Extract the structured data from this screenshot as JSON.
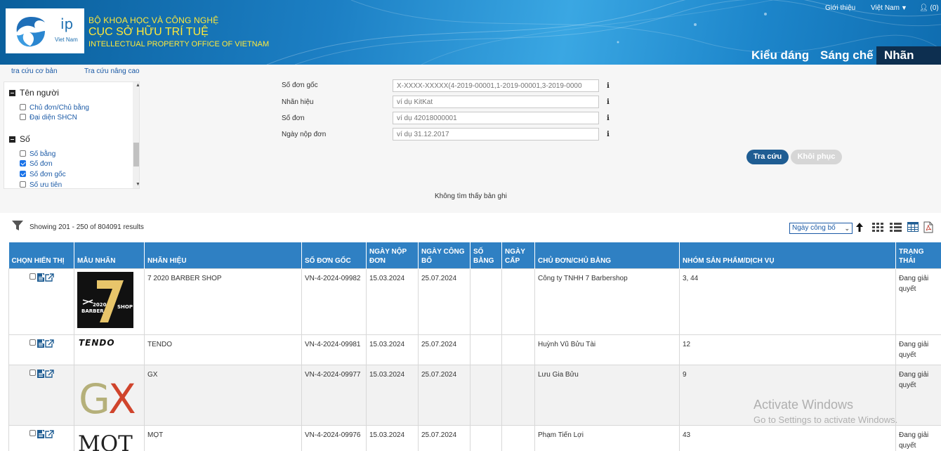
{
  "header": {
    "logo": {
      "ip_text": "ip",
      "sub_text": "Viet Nam"
    },
    "org_line1": "BỘ KHOA HỌC VÀ CÔNG NGHỆ",
    "org_line2": "CỤC SỞ HỮU TRÍ TUỆ",
    "org_line3": "INTELLECTUAL PROPERTY OFFICE OF VIETNAM",
    "links": {
      "intro": "Giới thiệu",
      "language": "Việt Nam",
      "user": "(0)"
    },
    "tabs": [
      {
        "label": "Kiểu dáng",
        "active": false
      },
      {
        "label": "Sáng chế",
        "active": false
      },
      {
        "label": "Nhãn hiệu",
        "active": true
      }
    ]
  },
  "search_modes": {
    "basic": "tra cứu cơ bản",
    "advanced": "Tra cứu nâng cao"
  },
  "filters": {
    "groups": [
      {
        "title": "Tên người",
        "items": [
          {
            "label": "Chủ đơn/Chủ bằng",
            "checked": false
          },
          {
            "label": "Đại diện SHCN",
            "checked": false
          }
        ]
      },
      {
        "title": "Số",
        "items": [
          {
            "label": "Số bằng",
            "checked": false
          },
          {
            "label": "Số đơn",
            "checked": true
          },
          {
            "label": "Số đơn gốc",
            "checked": true
          },
          {
            "label": "Số ưu tiên",
            "checked": false
          }
        ]
      }
    ]
  },
  "form": {
    "fields": [
      {
        "label": "Số đơn gốc",
        "placeholder": "X-XXXX-XXXXX(4-2019-00001,1-2019-00001,3-2019-0000",
        "value": ""
      },
      {
        "label": "Nhãn hiệu",
        "placeholder": "ví dụ KitKat",
        "value": ""
      },
      {
        "label": "Số đơn",
        "placeholder": "ví dụ 42018000001",
        "value": ""
      },
      {
        "label": "Ngày nộp đơn",
        "placeholder": "ví dụ 31.12.2017",
        "value": ""
      }
    ],
    "info_glyph": "i",
    "search_button": "Tra cứu",
    "reset_button": "Khôi phục",
    "no_records": "Không tìm thấy bản ghi"
  },
  "results": {
    "showing": "Showing 201 - 250 of 804091 results",
    "sort_by": "Ngày công bố",
    "columns": [
      "Chọn hiển thị",
      "Mẫu nhãn",
      "Nhãn hiệu",
      "Số đơn gốc",
      "Ngày nộp đơn",
      "Ngày công bố",
      "Số bằng",
      "Ngày cấp",
      "Chủ đơn/Chủ bằng",
      "Nhóm sản phẩm/dịch vụ",
      "Trạng thái"
    ],
    "rows": [
      {
        "mark": "7 2020 BARBER SHOP",
        "app_no": "VN-4-2024-09982",
        "filing_date": "15.03.2024",
        "pub_date": "25.07.2024",
        "reg_no": "",
        "grant_date": "",
        "owner": "Công ty TNHH 7 Barbershop",
        "classes": "3, 44",
        "status": "Đang giải quyết",
        "logo": {
          "big": "7",
          "text_top": "2020",
          "text_left": "BARBER",
          "text_right": "SHOP"
        }
      },
      {
        "mark": "TENDO",
        "app_no": "VN-4-2024-09981",
        "filing_date": "15.03.2024",
        "pub_date": "25.07.2024",
        "reg_no": "",
        "grant_date": "",
        "owner": "Huỳnh Vũ Bửu Tài",
        "classes": "12",
        "status": "Đang giải quyết",
        "logo": {
          "text": "TENDO"
        }
      },
      {
        "mark": "GX",
        "app_no": "VN-4-2024-09977",
        "filing_date": "15.03.2024",
        "pub_date": "25.07.2024",
        "reg_no": "",
        "grant_date": "",
        "owner": "Lưu Gia Bửu",
        "classes": "9",
        "status": "Đang giải quyết",
        "logo": {
          "left": "G",
          "right": "X"
        }
      },
      {
        "mark": "MỌT",
        "app_no": "VN-4-2024-09976",
        "filing_date": "15.03.2024",
        "pub_date": "25.07.2024",
        "reg_no": "",
        "grant_date": "",
        "owner": "Phạm Tiến Lợi",
        "classes": "43",
        "status": "Đang giải quyết",
        "logo": {
          "text": "MỌT"
        }
      }
    ]
  },
  "watermark": {
    "line1": "Activate Windows",
    "line2": "Go to Settings to activate Windows."
  },
  "colors": {
    "header_blue": "#1c7fc4",
    "table_header": "#2f80c3",
    "active_tab": "#0d2f50",
    "link": "#1b5aa6",
    "gold": "#ffe93a"
  }
}
